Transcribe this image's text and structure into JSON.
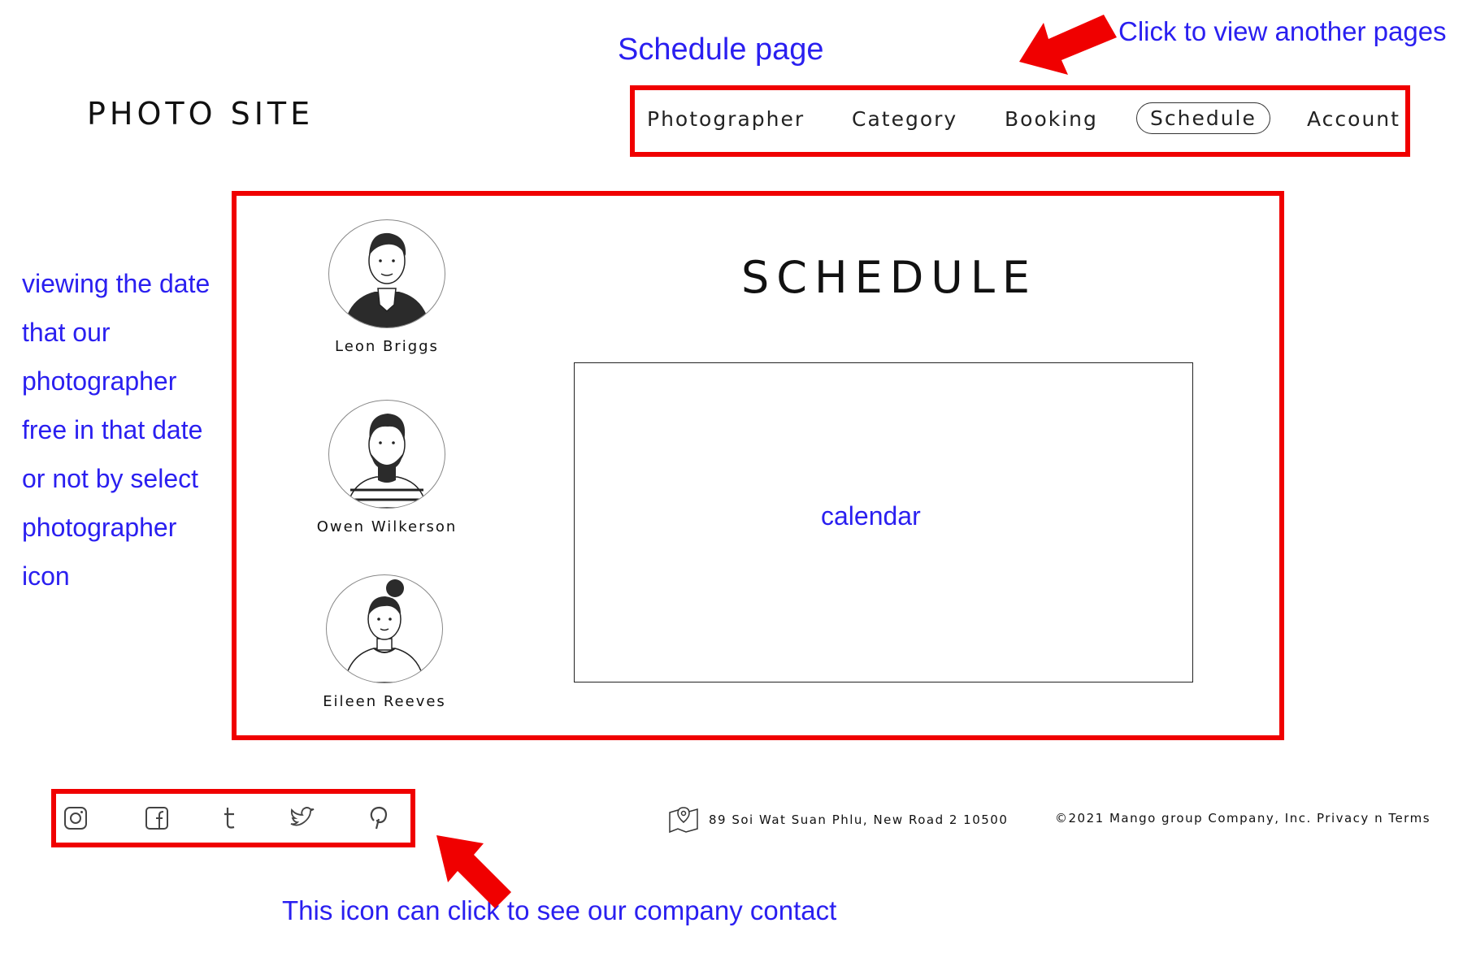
{
  "annotations": {
    "page_label": "Schedule page",
    "nav_hint": "Click to view another pages",
    "left_note_lines": [
      "viewing the date",
      "that our",
      "photographer",
      "free in that date",
      "or not by select",
      "photographer",
      "icon"
    ],
    "footer_hint": "This icon can click to see our company contact",
    "calendar_placeholder": "calendar"
  },
  "header": {
    "brand": "PHOTO SITE",
    "nav": [
      "Photographer",
      "Category",
      "Booking",
      "Schedule",
      "Account"
    ],
    "active_nav": "Schedule"
  },
  "main": {
    "title": "SCHEDULE",
    "photographers": [
      {
        "name": "Leon Briggs"
      },
      {
        "name": "Owen Wilkerson"
      },
      {
        "name": "Eileen Reeves"
      }
    ]
  },
  "footer": {
    "social_icons": [
      "instagram-icon",
      "facebook-icon",
      "tumblr-icon",
      "twitter-icon",
      "pinterest-icon"
    ],
    "address": "89 Soi Wat Suan Phlu, New Road 2 10500",
    "copyright": "©2021 Mango group Company, Inc. Privacy n Terms"
  },
  "colors": {
    "annotation": "#2a1ff0",
    "highlight_box": "#f00000",
    "text": "#111111"
  }
}
